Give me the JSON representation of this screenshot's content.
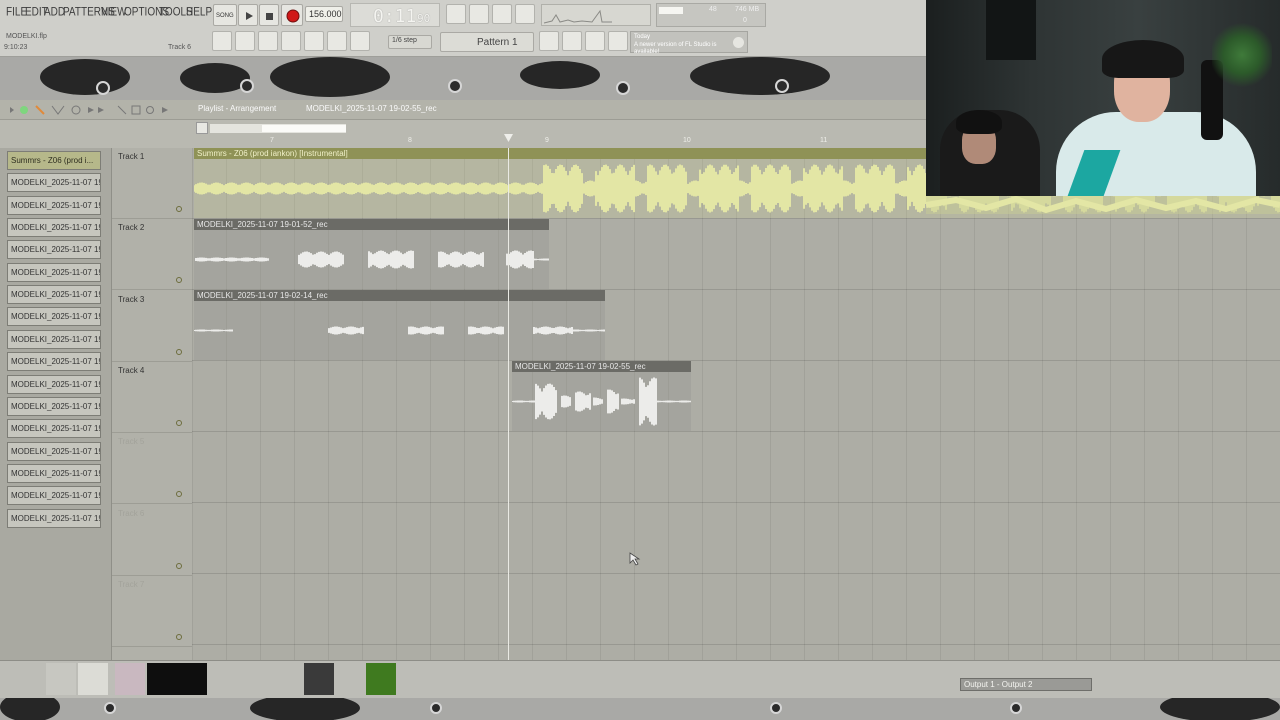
{
  "menu": {
    "items": [
      "FILE",
      "EDIT",
      "ADD",
      "PATTERNS",
      "VIEW",
      "OPTIONS",
      "TOOLS",
      "HELP"
    ]
  },
  "project": {
    "file_name": "MODELKI.flp",
    "time": "9:10:23",
    "track_hint": "Track 6"
  },
  "transport": {
    "mode": "SONG",
    "tempo": "156.000",
    "time_display": "0:11",
    "time_ms": "90"
  },
  "monitor": {
    "voices": "48",
    "memory": "746 MB",
    "cpu": "0"
  },
  "snap": {
    "value": "1/6 step"
  },
  "pattern": {
    "name": "Pattern 1"
  },
  "notification": {
    "day": "Today",
    "text": "A newer version of FL Studio is available!"
  },
  "playlist": {
    "title": "Playlist - Arrangement",
    "current_clip": "MODELKI_2025-11-07 19-02-55_rec",
    "bars": [
      "7",
      "8",
      "9",
      "10",
      "11"
    ],
    "picker": [
      "Summrs - Z06 (prod i...",
      "MODELKI_2025-11-07 19...",
      "MODELKI_2025-11-07 19...",
      "MODELKI_2025-11-07 19...",
      "MODELKI_2025-11-07 19...",
      "MODELKI_2025-11-07 19...",
      "MODELKI_2025-11-07 19...",
      "MODELKI_2025-11-07 19...",
      "MODELKI_2025-11-07 19...",
      "MODELKI_2025-11-07 19...",
      "MODELKI_2025-11-07 19...",
      "MODELKI_2025-11-07 19...",
      "MODELKI_2025-11-07 19...",
      "MODELKI_2025-11-07 19...",
      "MODELKI_2025-11-07 19...",
      "MODELKI_2025-11-07 19...",
      "MODELKI_2025-11-07 19..."
    ],
    "tracks": [
      "Track 1",
      "Track 2",
      "Track 3",
      "Track 4",
      "Track 5",
      "Track 6",
      "Track 7"
    ],
    "clips": {
      "song": "Summrs - Z06 (prod iankon) [Instrumental]",
      "rec1": "MODELKI_2025-11-07 19-01-52_rec",
      "rec2": "MODELKI_2025-11-07 19-02-14_rec",
      "rec3": "MODELKI_2025-11-07 19-02-55_rec"
    }
  },
  "output": {
    "label": "Output 1 - Output 2"
  },
  "colors": {
    "song_clip": "#8f9256",
    "audio_clip": "#6b6b66",
    "record": "#d01818",
    "channel_green": "#3f7a1f"
  }
}
